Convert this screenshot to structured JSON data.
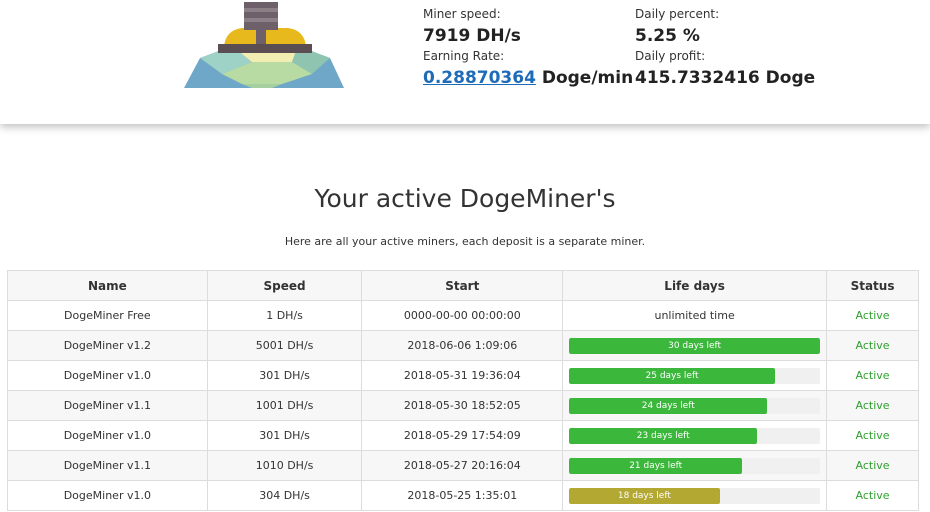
{
  "header": {
    "miner_speed_label": "Miner speed:",
    "miner_speed_value": "7919 DH/s",
    "earning_rate_label": "Earning Rate:",
    "earning_rate_value": "0.28870364",
    "earning_rate_unit": "Doge/min",
    "daily_percent_label": "Daily percent:",
    "daily_percent_value": "5.25 %",
    "daily_profit_label": "Daily profit:",
    "daily_profit_value": "415.7332416 Doge"
  },
  "main": {
    "title": "Your active DogeMiner's",
    "subtitle": "Here are all your active miners, each deposit is a separate miner."
  },
  "colors": {
    "progress_green": "#3bb83b",
    "progress_olive": "#b3a832",
    "link_blue": "#1e6bb8",
    "status_green": "#2e9e2e"
  },
  "table": {
    "headers": [
      "Name",
      "Speed",
      "Start",
      "Life days",
      "Status"
    ],
    "rows": [
      {
        "name": "DogeMiner Free",
        "speed": "1 DH/s",
        "start": "0000-00-00 00:00:00",
        "life_text": "unlimited time",
        "progress": null,
        "color": null,
        "status": "Active"
      },
      {
        "name": "DogeMiner v1.2",
        "speed": "5001 DH/s",
        "start": "2018-06-06 1:09:06",
        "life_text": "30 days left",
        "progress": 1.0,
        "color": "#3bb83b",
        "status": "Active"
      },
      {
        "name": "DogeMiner v1.0",
        "speed": "301 DH/s",
        "start": "2018-05-31 19:36:04",
        "life_text": "25 days left",
        "progress": 0.82,
        "color": "#3bb83b",
        "status": "Active"
      },
      {
        "name": "DogeMiner v1.1",
        "speed": "1001 DH/s",
        "start": "2018-05-30 18:52:05",
        "life_text": "24 days left",
        "progress": 0.79,
        "color": "#3bb83b",
        "status": "Active"
      },
      {
        "name": "DogeMiner v1.0",
        "speed": "301 DH/s",
        "start": "2018-05-29 17:54:09",
        "life_text": "23 days left",
        "progress": 0.75,
        "color": "#3bb83b",
        "status": "Active"
      },
      {
        "name": "DogeMiner v1.1",
        "speed": "1010 DH/s",
        "start": "2018-05-27 20:16:04",
        "life_text": "21 days left",
        "progress": 0.69,
        "color": "#3bb83b",
        "status": "Active"
      },
      {
        "name": "DogeMiner v1.0",
        "speed": "304 DH/s",
        "start": "2018-05-25 1:35:01",
        "life_text": "18 days left",
        "progress": 0.6,
        "color": "#b3a832",
        "status": "Active"
      }
    ]
  }
}
